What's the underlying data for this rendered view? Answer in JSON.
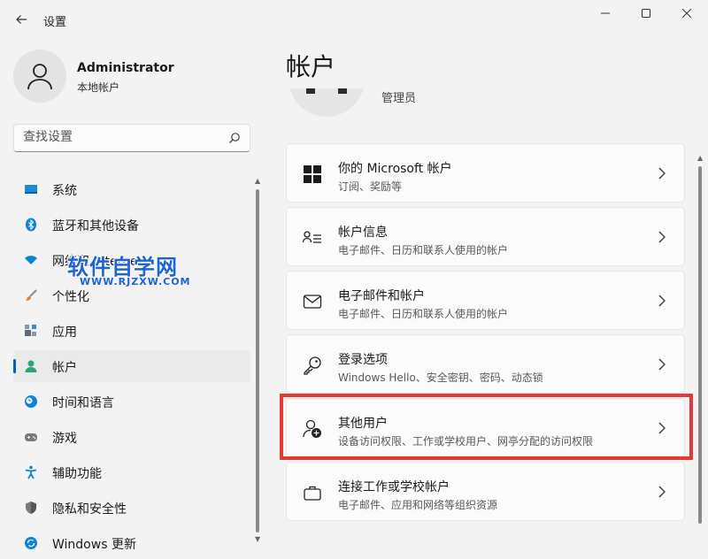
{
  "window": {
    "title": "设置"
  },
  "user": {
    "name": "Administrator",
    "type": "本地帐户"
  },
  "search": {
    "placeholder": "查找设置"
  },
  "sidebar": {
    "items": [
      {
        "label": "系统",
        "icon": "system-icon",
        "color": "#0a84d6"
      },
      {
        "label": "蓝牙和其他设备",
        "icon": "bluetooth-icon",
        "color": "#0a84d6"
      },
      {
        "label": "网络和 Internet",
        "icon": "network-icon",
        "color": "#0a84d6"
      },
      {
        "label": "个性化",
        "icon": "brush-icon",
        "color": "#e0832e"
      },
      {
        "label": "应用",
        "icon": "apps-icon",
        "color": "#5b6b7a"
      },
      {
        "label": "帐户",
        "icon": "account-icon",
        "color": "#2ba375",
        "active": true
      },
      {
        "label": "时间和语言",
        "icon": "time-language-icon",
        "color": "#0a84d6"
      },
      {
        "label": "游戏",
        "icon": "gaming-icon",
        "color": "#6b6b6b"
      },
      {
        "label": "辅助功能",
        "icon": "accessibility-icon",
        "color": "#0a84d6"
      },
      {
        "label": "隐私和安全性",
        "icon": "privacy-shield-icon",
        "color": "#6b6b6b"
      },
      {
        "label": "Windows 更新",
        "icon": "windows-update-icon",
        "color": "#0a84d6"
      }
    ]
  },
  "watermark": {
    "main": "软件自学网",
    "sub": "WWW.RJZXW.COM"
  },
  "main": {
    "title": "帐户",
    "role": "管理员",
    "cards": [
      {
        "title": "你的 Microsoft 帐户",
        "desc": "订阅、奖励等",
        "icon": "microsoft-logo-icon"
      },
      {
        "title": "帐户信息",
        "desc": "电子邮件、日历和联系人使用的帐户",
        "icon": "account-info-icon"
      },
      {
        "title": "电子邮件和帐户",
        "desc": "电子邮件、日历和联系人使用的帐户",
        "icon": "mail-icon"
      },
      {
        "title": "登录选项",
        "desc": "Windows Hello、安全密钥、密码、动态锁",
        "icon": "key-icon"
      },
      {
        "title": "其他用户",
        "desc": "设备访问权限、工作或学校用户、网亭分配的访问权限",
        "icon": "add-user-icon"
      },
      {
        "title": "连接工作或学校帐户",
        "desc": "电子邮件、应用和网络等组织资源",
        "icon": "briefcase-icon"
      }
    ]
  },
  "colors": {
    "accent": "#005fb8",
    "highlight": "#e53935"
  }
}
